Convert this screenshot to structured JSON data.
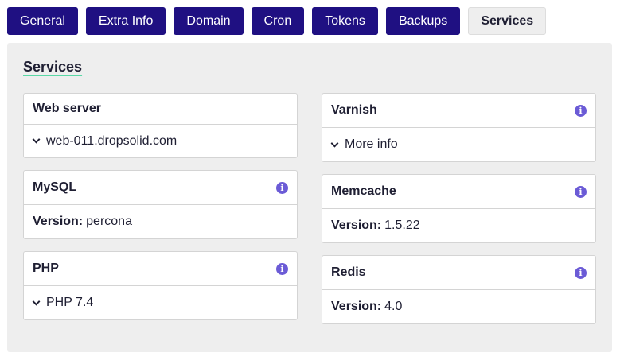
{
  "tabs": [
    {
      "label": "General",
      "active": false
    },
    {
      "label": "Extra Info",
      "active": false
    },
    {
      "label": "Domain",
      "active": false
    },
    {
      "label": "Cron",
      "active": false
    },
    {
      "label": "Tokens",
      "active": false
    },
    {
      "label": "Backups",
      "active": false
    },
    {
      "label": "Services",
      "active": true
    }
  ],
  "section": {
    "title": "Services"
  },
  "cards": {
    "webserver": {
      "title": "Web server",
      "value": "web-011.dropsolid.com"
    },
    "mysql": {
      "title": "MySQL",
      "version_label": "Version:",
      "version": "percona",
      "info_icon": "info-icon"
    },
    "php": {
      "title": "PHP",
      "value": "PHP 7.4",
      "info_icon": "info-icon"
    },
    "varnish": {
      "title": "Varnish",
      "value": "More info",
      "info_icon": "info-icon"
    },
    "memcache": {
      "title": "Memcache",
      "version_label": "Version:",
      "version": "1.5.22",
      "info_icon": "info-icon"
    },
    "redis": {
      "title": "Redis",
      "version_label": "Version:",
      "version": "4.0",
      "info_icon": "info-icon"
    }
  },
  "colors": {
    "tab_bg": "#1f1082",
    "panel_bg": "#eeeeee",
    "info_icon": "#6b5bd6",
    "title_underline": "#5ad8a6"
  }
}
